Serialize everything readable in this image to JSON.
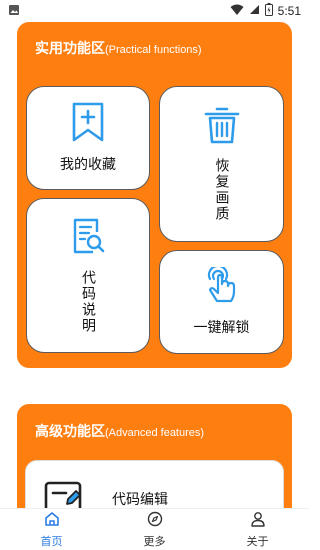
{
  "status_bar": {
    "time": "5:51"
  },
  "panel_practical": {
    "title_cn": "实用功能区",
    "title_en": "(Practical functions)",
    "cards": {
      "favorites": "我的收藏",
      "restore": "恢复画质",
      "code_doc": "代码说明",
      "unlock": "一键解锁"
    }
  },
  "panel_advanced": {
    "title_cn": "高级功能区",
    "title_en": "(Advanced features)",
    "cards": {
      "editor": "代码编辑"
    }
  },
  "bottom_nav": {
    "items": [
      {
        "label": "首页",
        "icon": "home-icon",
        "active": true
      },
      {
        "label": "更多",
        "icon": "compass-icon",
        "active": false
      },
      {
        "label": "关于",
        "icon": "user-icon",
        "active": false
      }
    ]
  },
  "colors": {
    "accent": "#FF7E10",
    "icon_blue": "#2E9BEB",
    "nav_active": "#2c7be5"
  }
}
